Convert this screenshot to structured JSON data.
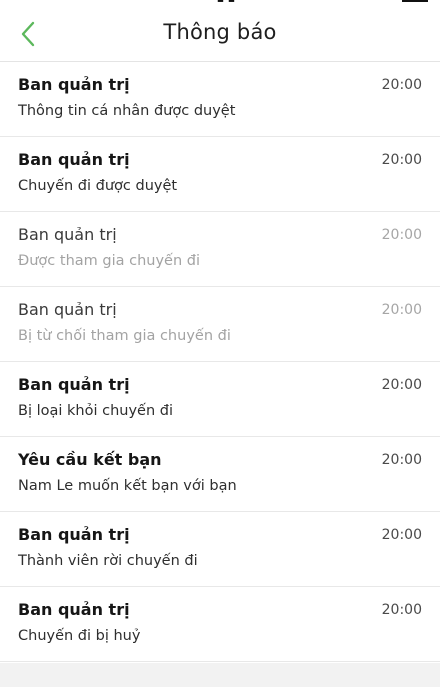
{
  "header": {
    "title": "Thông báo",
    "accent_color": "#5cb85c"
  },
  "notifications": [
    {
      "sender": "Ban quản trị",
      "time": "20:00",
      "message": "Thông tin cá nhân được duyệt",
      "read": false
    },
    {
      "sender": "Ban quản trị",
      "time": "20:00",
      "message": "Chuyến đi được duyệt",
      "read": false
    },
    {
      "sender": "Ban quản trị",
      "time": "20:00",
      "message": "Được tham gia chuyến đi",
      "read": true
    },
    {
      "sender": "Ban quản trị",
      "time": "20:00",
      "message": "Bị từ chối tham gia chuyến đi",
      "read": true
    },
    {
      "sender": "Ban quản trị",
      "time": "20:00",
      "message": "Bị loại khỏi chuyến đi",
      "read": false
    },
    {
      "sender": "Yêu cầu kết bạn",
      "time": "20:00",
      "message": "Nam Le muốn kết bạn với bạn",
      "read": false
    },
    {
      "sender": "Ban quản trị",
      "time": "20:00",
      "message": "Thành viên rời chuyến đi",
      "read": false
    },
    {
      "sender": "Ban quản trị",
      "time": "20:00",
      "message": "Chuyến đi bị huỷ",
      "read": false
    }
  ]
}
